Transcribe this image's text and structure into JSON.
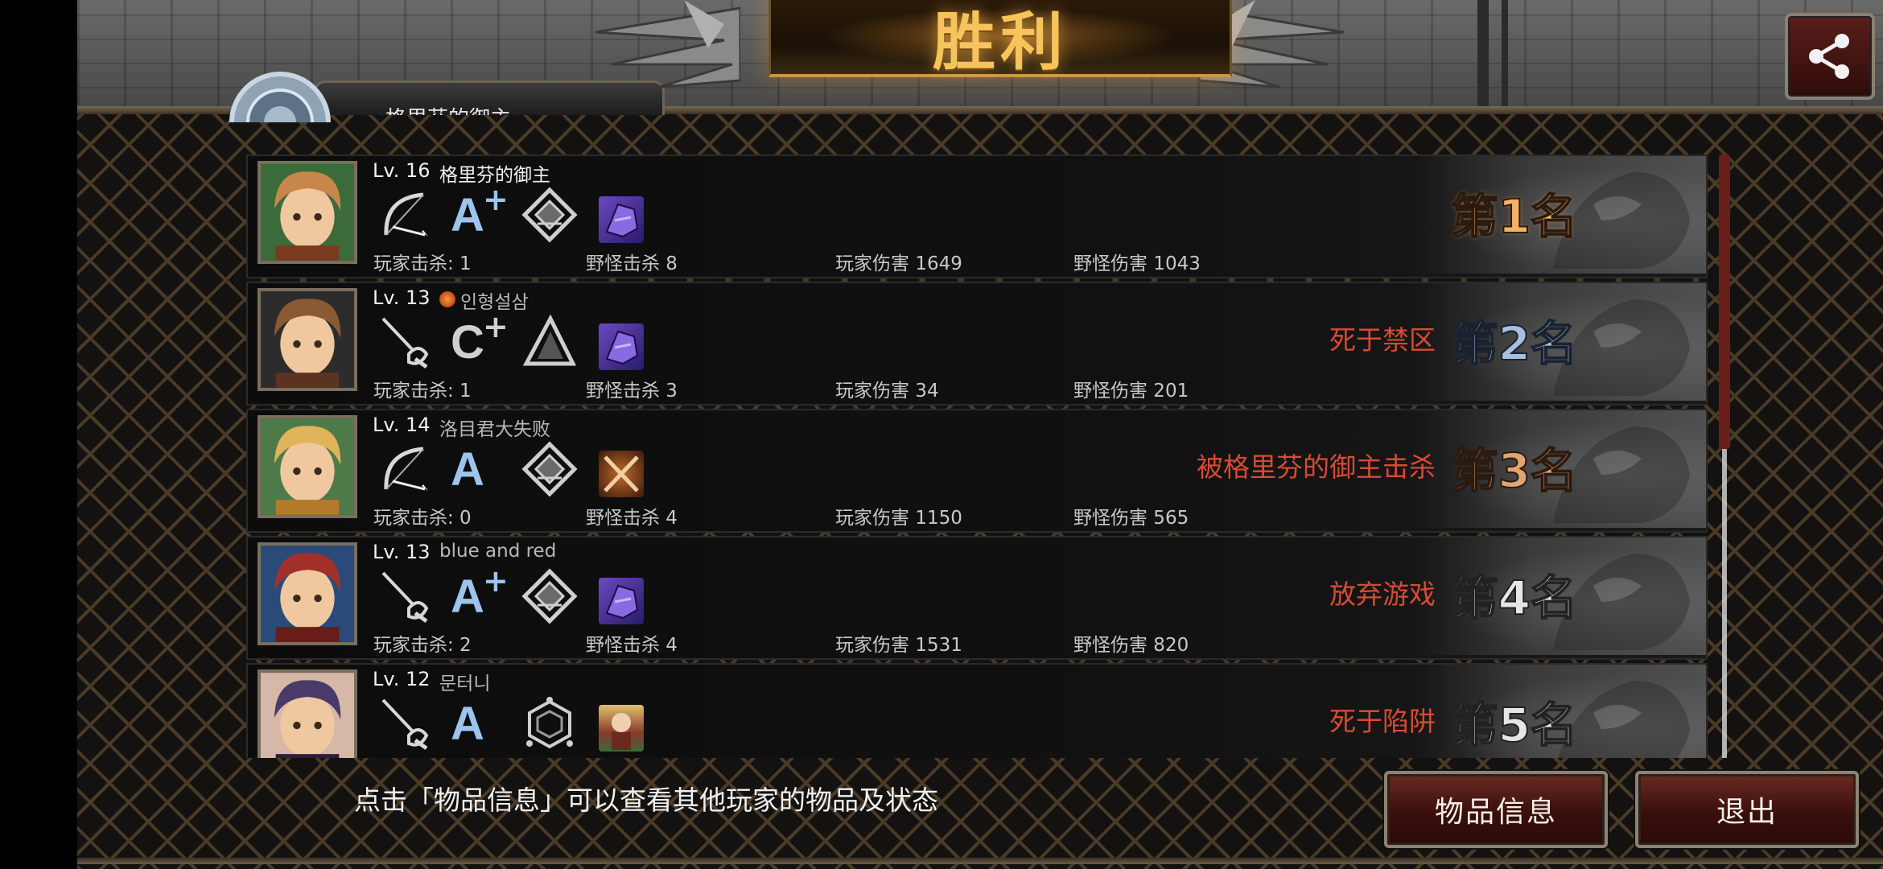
{
  "header": {
    "title": "胜利",
    "winner_plate_name": "格里芬的御主"
  },
  "colors": {
    "status_red": "#d94a34",
    "button_red": "#3a0f0c",
    "rank_gold": "#f4b266"
  },
  "players": [
    {
      "level": "Lv. 16",
      "name": "格里芬的御主",
      "is_self": true,
      "weapon_icon": "bow-icon",
      "grade": "A",
      "grade_plus": "+",
      "skill_icon": "diamond-emblem-icon",
      "item_icon": "purple-gauntlet-icon",
      "player_kills": "玩家击杀: 1",
      "monster_kills": "野怪击杀 8",
      "player_damage": "玩家伤害 1649",
      "monster_damage": "野怪伤害 1043",
      "status": "",
      "rank": "第1名"
    },
    {
      "level": "Lv. 13",
      "name": "인형설삼",
      "is_self": false,
      "name_prefix_icon": "ginseng-icon",
      "weapon_icon": "rapier-icon",
      "grade": "C",
      "grade_plus": "+",
      "skill_icon": "triangle-emblem-icon",
      "item_icon": "purple-gauntlet-icon",
      "player_kills": "玩家击杀: 1",
      "monster_kills": "野怪击杀 3",
      "player_damage": "玩家伤害 34",
      "monster_damage": "野怪伤害 201",
      "status": "死于禁区",
      "rank": "第2名"
    },
    {
      "level": "Lv. 14",
      "name": "洛目君大失败",
      "is_self": false,
      "weapon_icon": "bow-icon",
      "grade": "A",
      "grade_plus": "",
      "skill_icon": "diamond-emblem-icon",
      "item_icon": "crossed-blades-icon",
      "player_kills": "玩家击杀: 0",
      "monster_kills": "野怪击杀 4",
      "player_damage": "玩家伤害 1150",
      "monster_damage": "野怪伤害 565",
      "status": "被格里芬的御主击杀",
      "rank": "第3名"
    },
    {
      "level": "Lv. 13",
      "name": "blue and red",
      "is_self": false,
      "weapon_icon": "rapier-icon",
      "grade": "A",
      "grade_plus": "+",
      "skill_icon": "diamond-emblem-icon",
      "item_icon": "purple-gauntlet-icon",
      "player_kills": "玩家击杀: 2",
      "monster_kills": "野怪击杀 4",
      "player_damage": "玩家伤害 1531",
      "monster_damage": "野怪伤害 820",
      "status": "放弃游戏",
      "rank": "第4名"
    },
    {
      "level": "Lv. 12",
      "name": "문터니",
      "is_self": false,
      "weapon_icon": "rapier-icon",
      "grade": "A",
      "grade_plus": "",
      "skill_icon": "hexagon-emblem-icon",
      "item_icon": "character-card-icon",
      "player_kills": "",
      "monster_kills": "",
      "player_damage": "",
      "monster_damage": "",
      "status": "死于陷阱",
      "rank": "第5名"
    }
  ],
  "footer": {
    "hint": "点击「物品信息」可以查看其他玩家的物品及状态",
    "item_info_label": "物品信息",
    "exit_label": "退出"
  }
}
